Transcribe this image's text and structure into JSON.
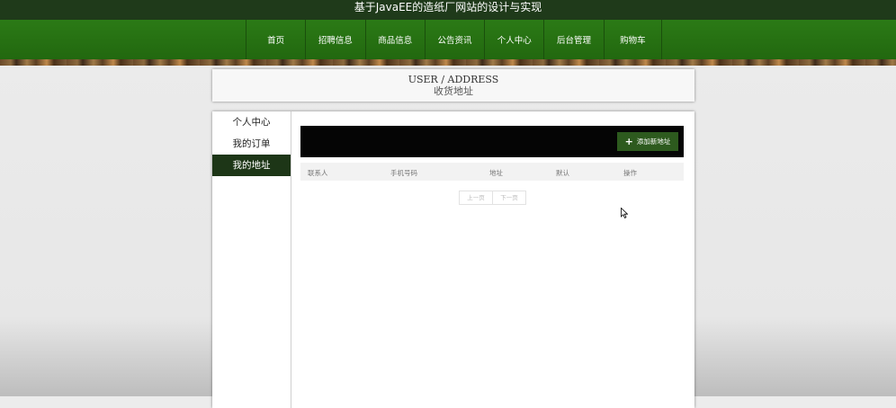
{
  "site_title": "基于JavaEE的造纸厂网站的设计与实现",
  "nav": {
    "items": [
      "首页",
      "招聘信息",
      "商品信息",
      "公告资讯",
      "个人中心",
      "后台管理",
      "购物车"
    ]
  },
  "page_header": {
    "en": "USER / ADDRESS",
    "cn": "收货地址"
  },
  "sidebar": {
    "items": [
      "个人中心",
      "我的订单",
      "我的地址"
    ],
    "active_index": 2
  },
  "toolbar": {
    "add_label": "添加新地址"
  },
  "table": {
    "columns": [
      "联系人",
      "手机号码",
      "地址",
      "默认",
      "操作"
    ]
  },
  "pager": {
    "prev": "上一页",
    "next": "下一页"
  },
  "colors": {
    "nav_green": "#2b7a16",
    "top_dark": "#1f3a1a",
    "active_sidebar": "#1d3617",
    "button_green": "#2d5a1e"
  }
}
